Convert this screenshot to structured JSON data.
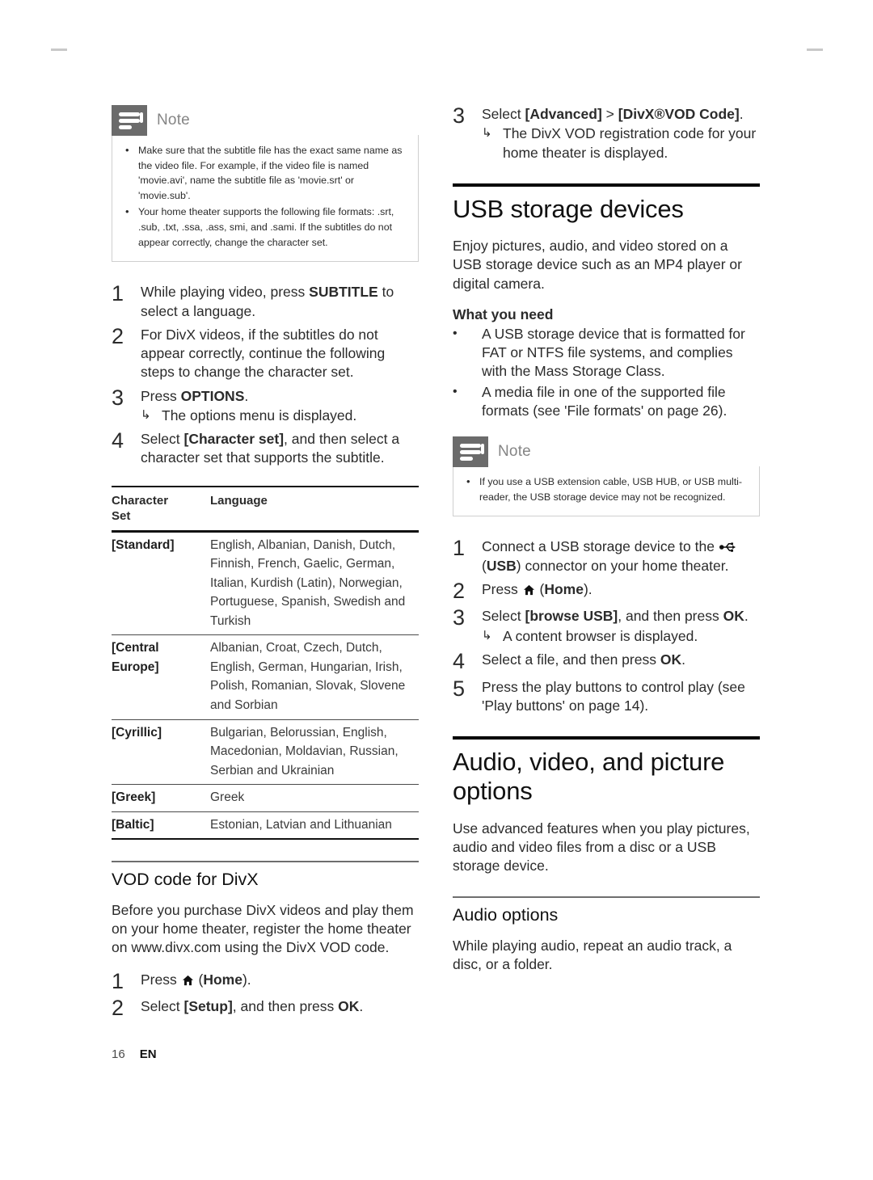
{
  "crop_marks": {
    "left_label": "crop-mark-left",
    "right_label": "crop-mark-right"
  },
  "footer": {
    "page_number": "16",
    "language": "EN"
  },
  "left_column": {
    "note": {
      "title": "Note",
      "icon": "note-lines-icon",
      "bullets": [
        "Make sure that the subtitle file has the exact same name as the video file. For example, if the video file is named 'movie.avi', name the subtitle file as 'movie.srt' or 'movie.sub'.",
        "Your home theater supports the following file formats: .srt, .sub, .txt, .ssa, .ass, smi, and .sami. If the subtitles do not appear correctly, change the character set."
      ]
    },
    "steps": [
      {
        "num": "1",
        "text_a": "While playing video, press ",
        "bold": "SUBTITLE",
        "text_b": " to select a language.",
        "substep": ""
      },
      {
        "num": "2",
        "text_a": "For DivX videos, if the subtitles do not appear correctly, continue the following steps to change the character set.",
        "bold": "",
        "text_b": "",
        "substep": ""
      },
      {
        "num": "3",
        "text_a": "Press ",
        "bold": "OPTIONS",
        "text_b": ".",
        "substep": "The options menu is displayed."
      },
      {
        "num": "4",
        "text_a": "Select ",
        "bold": "[Character set]",
        "text_b": ", and then select a character set that supports the subtitle.",
        "substep": ""
      }
    ],
    "table": {
      "headers": [
        "Character Set",
        "Language"
      ],
      "header_line1": "Character",
      "header_line2": "Set",
      "rows": [
        {
          "set": "[Standard]",
          "languages": "English, Albanian, Danish, Dutch, Finnish, French, Gaelic, German, Italian, Kurdish (Latin), Norwegian, Portuguese, Spanish, Swedish and Turkish"
        },
        {
          "set": "[Central Europe]",
          "languages": "Albanian, Croat, Czech, Dutch, English, German, Hungarian, Irish, Polish, Romanian, Slovak, Slovene and Sorbian"
        },
        {
          "set": "[Cyrillic]",
          "languages": "Bulgarian, Belorussian, English, Macedonian, Moldavian, Russian, Serbian and Ukrainian"
        },
        {
          "set": "[Greek]",
          "languages": "Greek"
        },
        {
          "set": "[Baltic]",
          "languages": "Estonian, Latvian and Lithuanian"
        }
      ]
    },
    "vod_section": {
      "heading": "VOD code for DivX",
      "paragraph": "Before you purchase DivX videos and play them on your home theater, register the home theater on www.divx.com using the DivX VOD code.",
      "steps": [
        {
          "num": "1",
          "text_a": "Press ",
          "icon": "home-icon",
          "text_mid": " (",
          "bold": "Home",
          "text_b": ")."
        },
        {
          "num": "2",
          "text_a": "Select ",
          "bold": "[Setup]",
          "text_b": ", and then press ",
          "bold2": "OK",
          "text_c": "."
        }
      ]
    }
  },
  "right_column": {
    "top_step": {
      "num": "3",
      "text_a": "Select ",
      "bold": "[Advanced]",
      "text_mid": " > ",
      "bold2": "[DivX®VOD Code]",
      "text_b": ".",
      "substep": "The DivX VOD registration code for your home theater is displayed."
    },
    "usb_section": {
      "heading": "USB storage devices",
      "intro": "Enjoy pictures, audio, and video stored on a USB storage device such as an MP4 player or digital camera.",
      "what_you_need_title": "What you need",
      "requirements": [
        "A USB storage device that is formatted for FAT or NTFS file systems, and complies with the Mass Storage Class.",
        "A media file in one of the supported file formats (see 'File formats' on page 26)."
      ],
      "note": {
        "title": "Note",
        "icon": "note-lines-icon",
        "bullets": [
          "If you use a USB extension cable, USB HUB, or USB multi-reader, the USB storage device may not be recognized."
        ]
      },
      "steps": [
        {
          "num": "1",
          "text_a": "Connect a USB storage device to the ",
          "icon": "usb-icon",
          "text_mid": " (",
          "bold": "USB",
          "text_b": ") connector on your home theater."
        },
        {
          "num": "2",
          "text_a": "Press ",
          "icon": "home-icon",
          "text_mid": " (",
          "bold": "Home",
          "text_b": ")."
        },
        {
          "num": "3",
          "text_a": "Select ",
          "bold": "[browse USB]",
          "text_b": ", and then press ",
          "bold2": "OK",
          "text_c": ".",
          "substep": "A content browser is displayed."
        },
        {
          "num": "4",
          "text_a": "Select a file, and then press ",
          "bold": "OK",
          "text_b": "."
        },
        {
          "num": "5",
          "text_a": "Press the play buttons to control play (see 'Play buttons' on page 14)."
        }
      ]
    },
    "avp_section": {
      "heading": "Audio, video, and picture options",
      "intro": "Use advanced features when you play pictures, audio and video files from a disc or a USB storage device.",
      "audio_options": {
        "heading": "Audio options",
        "text": "While playing audio, repeat an audio track, a disc, or a folder."
      }
    }
  }
}
